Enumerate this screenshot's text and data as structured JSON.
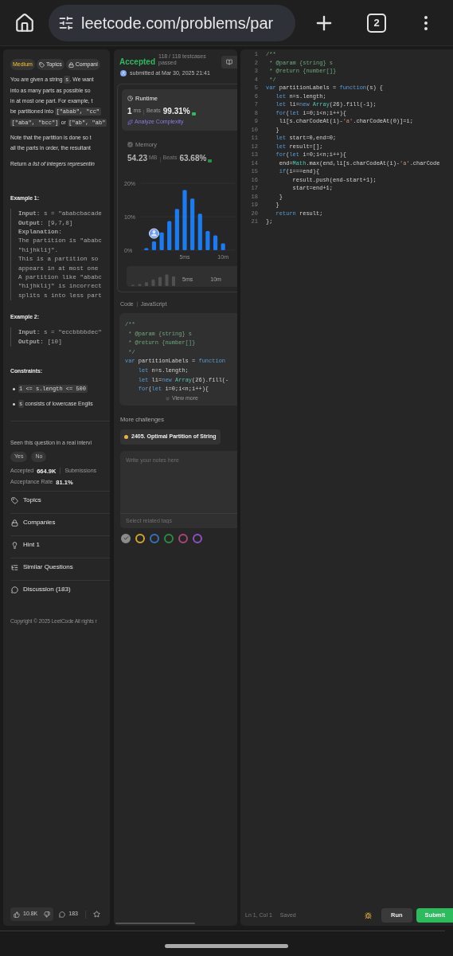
{
  "browser": {
    "url": "leetcode.com/problems/par",
    "tab_count": "2"
  },
  "description": {
    "tags": [
      {
        "kind": "difficulty",
        "label": "Medium"
      },
      {
        "kind": "topics",
        "label": "Topics"
      },
      {
        "kind": "companies",
        "label": "Compani"
      }
    ],
    "paragraphs": [
      [
        [
          {
            "kind": "text",
            "text": "You are given a string "
          },
          {
            "kind": "code",
            "text": "s"
          },
          {
            "kind": "text",
            "text": ". We want"
          }
        ],
        [
          {
            "kind": "text",
            "text": "into as many parts as possible so"
          }
        ],
        [
          {
            "kind": "text",
            "text": "in at most one part. For example, t"
          }
        ],
        [
          {
            "kind": "text",
            "text": "be partitioned into "
          },
          {
            "kind": "code",
            "text": "[\"abab\", \"cc\""
          }
        ],
        [
          {
            "kind": "code",
            "text": "[\"aba\", \"bcc\"]"
          },
          {
            "kind": "text",
            "text": " or "
          },
          {
            "kind": "code",
            "text": "[\"ab\", \"ab\""
          }
        ]
      ],
      [
        [
          {
            "kind": "text",
            "text": "Note that the partition is done so t"
          }
        ],
        [
          {
            "kind": "text",
            "text": "all the parts in order, the resultant"
          }
        ]
      ],
      [
        [
          {
            "kind": "text",
            "text": "Return *a list of integers representin*"
          }
        ]
      ]
    ],
    "examples": [
      {
        "title": "Example 1:",
        "lines": [
          "**Input:** s = \"ababcbacade",
          "**Output:** [9,7,8]",
          "**Explanation:**",
          "The partition is \"ababc",
          "\"hijhklij\".",
          "This is a partition so",
          "appears in at most one",
          "A partition like \"ababc",
          "\"hijhklij\" is incorrect",
          "splits s into less part"
        ]
      },
      {
        "title": "Example 2:",
        "lines": [
          "**Input:** s = \"eccbbbbdec\"",
          "**Output:** [10]"
        ]
      }
    ],
    "constraints": {
      "title": "Constraints:",
      "items": [
        [
          {
            "kind": "code",
            "text": "1 <= s.length <= 500"
          }
        ],
        [
          {
            "kind": "code",
            "text": "s"
          },
          {
            "kind": "text",
            "text": " consists of lowercase Englis"
          }
        ]
      ]
    },
    "feedback": {
      "question": "Seen this question in a real intervi",
      "buttons": [
        "Yes",
        "No"
      ]
    },
    "stats": {
      "accepted_label": "Accepted",
      "accepted": "664.9K",
      "submissions_label": "Submissions",
      "rate_label": "Acceptance Rate",
      "rate": "81.1%"
    },
    "sections": [
      {
        "kind": "topics",
        "label": "Topics"
      },
      {
        "kind": "companies",
        "label": "Companies"
      },
      {
        "kind": "hint",
        "label": "Hint 1"
      },
      {
        "kind": "similar",
        "label": "Similar Questions"
      },
      {
        "kind": "discussion",
        "label": "Discussion (183)"
      }
    ],
    "copyright": "Copyright © 2025 LeetCode All rights r",
    "footer": {
      "likes": "10.8K",
      "comments": "183"
    }
  },
  "submission": {
    "status": "Accepted",
    "testcases": "118 / 118 testcases passed",
    "submitted": "submitted at Mar 30, 2025 21:41",
    "metrics": [
      {
        "kind": "runtime",
        "selected": true,
        "title": "Runtime",
        "value": "1",
        "unit": "ms",
        "beats_label": "Beats",
        "beats": "99.31%",
        "analyze": "Analyze Complexity"
      },
      {
        "kind": "memory",
        "selected": false,
        "title": "Memory",
        "value": "54.23",
        "unit": "MB",
        "beats_label": "Beats",
        "beats": "63.68%"
      }
    ],
    "chart_data": {
      "type": "bar",
      "x": [
        0,
        1,
        2,
        3,
        4,
        5,
        6,
        7,
        8,
        9,
        10
      ],
      "values": [
        0.6,
        2.6,
        5.3,
        8.7,
        12.3,
        18,
        15.4,
        10.9,
        5.7,
        4.4,
        2
      ],
      "xlim": [
        -0.5,
        10.5
      ],
      "ylim": [
        0,
        20
      ],
      "xticks": [
        {
          "value": 5,
          "label": "5ms"
        },
        {
          "value": 10,
          "label": "10m"
        }
      ],
      "yticks": [
        {
          "value": 0,
          "label": "0%"
        },
        {
          "value": 10,
          "label": "10%"
        },
        {
          "value": 20,
          "label": "20%"
        }
      ]
    },
    "range_labels": [
      "5ms",
      "10m"
    ]
  },
  "code_preview": {
    "label": "Code",
    "language": "JavaScript",
    "view_more": "View more",
    "lines": [
      [
        {
          "kind": "comment",
          "text": "/**"
        }
      ],
      [
        {
          "kind": "comment",
          "text": " * @param {string} s"
        }
      ],
      [
        {
          "kind": "comment",
          "text": " * @return {number[]}"
        }
      ],
      [
        {
          "kind": "comment",
          "text": " */"
        }
      ],
      [
        {
          "kind": "keyword",
          "text": "var"
        },
        {
          "kind": "plain",
          "text": " partitionLabels = "
        },
        {
          "kind": "keyword",
          "text": "function"
        }
      ],
      [
        {
          "kind": "keyword",
          "text": "    let"
        },
        {
          "kind": "plain",
          "text": " n=s.length;"
        }
      ],
      [
        {
          "kind": "keyword",
          "text": "    let"
        },
        {
          "kind": "plain",
          "text": " li="
        },
        {
          "kind": "keyword",
          "text": "new"
        },
        {
          "kind": "type",
          "text": " Array"
        },
        {
          "kind": "plain",
          "text": "(26).fill(-"
        }
      ],
      [
        {
          "kind": "keyword",
          "text": "    for"
        },
        {
          "kind": "plain",
          "text": "("
        },
        {
          "kind": "keyword",
          "text": "let"
        },
        {
          "kind": "plain",
          "text": " i=0;i<n;i++){"
        }
      ]
    ]
  },
  "challenges": {
    "title": "More challenges",
    "items": [
      {
        "label": "2405. Optimal Partition of String",
        "color": "#e8b73a"
      }
    ]
  },
  "notes": {
    "placeholder": "Write your notes here",
    "tags_placeholder": "Select related tags",
    "colors": [
      {
        "color": "#8c8c8c",
        "selected": true
      },
      {
        "color": "#d4a72c",
        "selected": false
      },
      {
        "color": "#3b6fb6",
        "selected": false
      },
      {
        "color": "#2f8a3c",
        "selected": false
      },
      {
        "color": "#a8467a",
        "selected": false
      },
      {
        "color": "#8a52c2",
        "selected": false
      }
    ]
  },
  "editor": {
    "status": "Ln 1, Col 1",
    "saved": "Saved",
    "run": "Run",
    "submit": "Submit",
    "lines": [
      {
        "n": "1",
        "s": [
          {
            "kind": "comment",
            "text": "/**"
          }
        ]
      },
      {
        "n": "2",
        "s": [
          {
            "kind": "comment",
            "text": " * @param {string} s"
          }
        ]
      },
      {
        "n": "3",
        "s": [
          {
            "kind": "comment",
            "text": " * @return {number[]}"
          }
        ]
      },
      {
        "n": "4",
        "s": [
          {
            "kind": "comment",
            "text": " */"
          }
        ]
      },
      {
        "n": "5",
        "s": [
          {
            "kind": "keyword",
            "text": "var"
          },
          {
            "kind": "plain",
            "text": " partitionLabels = "
          },
          {
            "kind": "keyword",
            "text": "function"
          },
          {
            "kind": "plain",
            "text": "(s) {"
          }
        ]
      },
      {
        "n": "6",
        "s": [
          {
            "kind": "keyword",
            "text": "   let"
          },
          {
            "kind": "plain",
            "text": " n=s.length;"
          }
        ]
      },
      {
        "n": "7",
        "s": [
          {
            "kind": "keyword",
            "text": "   let"
          },
          {
            "kind": "plain",
            "text": " li="
          },
          {
            "kind": "keyword",
            "text": "new"
          },
          {
            "kind": "type",
            "text": " Array"
          },
          {
            "kind": "plain",
            "text": "(26).fill(-1);"
          }
        ]
      },
      {
        "n": "8",
        "s": [
          {
            "kind": "keyword",
            "text": "   for"
          },
          {
            "kind": "plain",
            "text": "("
          },
          {
            "kind": "keyword",
            "text": "let"
          },
          {
            "kind": "plain",
            "text": " i=0;i<n;i++){"
          }
        ]
      },
      {
        "n": "9",
        "s": [
          {
            "kind": "plain",
            "text": "    li[s.charCodeAt(i)-"
          },
          {
            "kind": "string",
            "text": "'a'"
          },
          {
            "kind": "plain",
            "text": ".charCodeAt(0)]=i;"
          }
        ]
      },
      {
        "n": "10",
        "s": [
          {
            "kind": "plain",
            "text": "   }"
          }
        ]
      },
      {
        "n": "11",
        "s": [
          {
            "kind": "keyword",
            "text": "   let"
          },
          {
            "kind": "plain",
            "text": " start=0,end=0;"
          }
        ]
      },
      {
        "n": "12",
        "s": [
          {
            "kind": "keyword",
            "text": "   let"
          },
          {
            "kind": "plain",
            "text": " result=[];"
          }
        ]
      },
      {
        "n": "13",
        "s": [
          {
            "kind": "keyword",
            "text": "   for"
          },
          {
            "kind": "plain",
            "text": "("
          },
          {
            "kind": "keyword",
            "text": "let"
          },
          {
            "kind": "plain",
            "text": " i=0;i<n;i++){"
          }
        ]
      },
      {
        "n": "14",
        "s": [
          {
            "kind": "plain",
            "text": "    end="
          },
          {
            "kind": "type",
            "text": "Math"
          },
          {
            "kind": "plain",
            "text": ".max(end,li[s.charCodeAt(i)-"
          },
          {
            "kind": "string",
            "text": "'a'"
          },
          {
            "kind": "plain",
            "text": ".charCode"
          }
        ]
      },
      {
        "n": "15",
        "s": [
          {
            "kind": "keyword",
            "text": "    if"
          },
          {
            "kind": "plain",
            "text": "(i===end){"
          }
        ]
      },
      {
        "n": "16",
        "s": [
          {
            "kind": "plain",
            "text": "        result.push(end-start+1);"
          }
        ]
      },
      {
        "n": "17",
        "s": [
          {
            "kind": "plain",
            "text": "        start=end+1;"
          }
        ]
      },
      {
        "n": "18",
        "s": [
          {
            "kind": "plain",
            "text": "    }"
          }
        ]
      },
      {
        "n": "19",
        "s": [
          {
            "kind": "plain",
            "text": "   }"
          }
        ]
      },
      {
        "n": "20",
        "s": [
          {
            "kind": "keyword",
            "text": "   return"
          },
          {
            "kind": "plain",
            "text": " result;"
          }
        ]
      },
      {
        "n": "21",
        "s": [
          {
            "kind": "plain",
            "text": "};"
          }
        ]
      }
    ]
  }
}
